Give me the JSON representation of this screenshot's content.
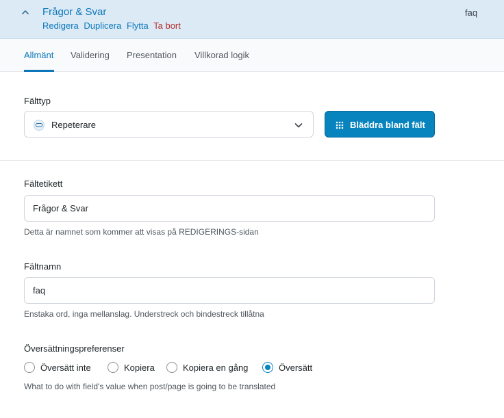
{
  "header": {
    "title": "Frågor & Svar",
    "field_key": "faq",
    "actions": {
      "edit": "Redigera",
      "duplicate": "Duplicera",
      "move": "Flytta",
      "delete": "Ta bort"
    }
  },
  "tabs": [
    {
      "label": "Allmänt",
      "active": true
    },
    {
      "label": "Validering",
      "active": false
    },
    {
      "label": "Presentation",
      "active": false
    },
    {
      "label": "Villkorad logik",
      "active": false
    }
  ],
  "field_type": {
    "label": "Fälttyp",
    "value": "Repeterare",
    "icon": "repeater-icon",
    "browse_button": "Bläddra bland fält"
  },
  "field_label": {
    "label": "Fältetikett",
    "value": "Frågor & Svar",
    "help": "Detta är namnet som kommer att visas på REDIGERINGS-sidan"
  },
  "field_name": {
    "label": "Fältnamn",
    "value": "faq",
    "help": "Enstaka ord, inga mellanslag. Understreck och bindestreck tillåtna"
  },
  "translation": {
    "label": "Översättningspreferenser",
    "options": [
      {
        "label": "Översätt inte",
        "checked": false
      },
      {
        "label": "Kopiera",
        "checked": false
      },
      {
        "label": "Kopiera en gång",
        "checked": false
      },
      {
        "label": "Översätt",
        "checked": true
      }
    ],
    "help": "What to do with field's value when post/page is going to be translated"
  },
  "colors": {
    "accent": "#0783be",
    "link": "#0c76bb",
    "delete": "#b32d2e",
    "header_bg": "#dbeaf5"
  }
}
